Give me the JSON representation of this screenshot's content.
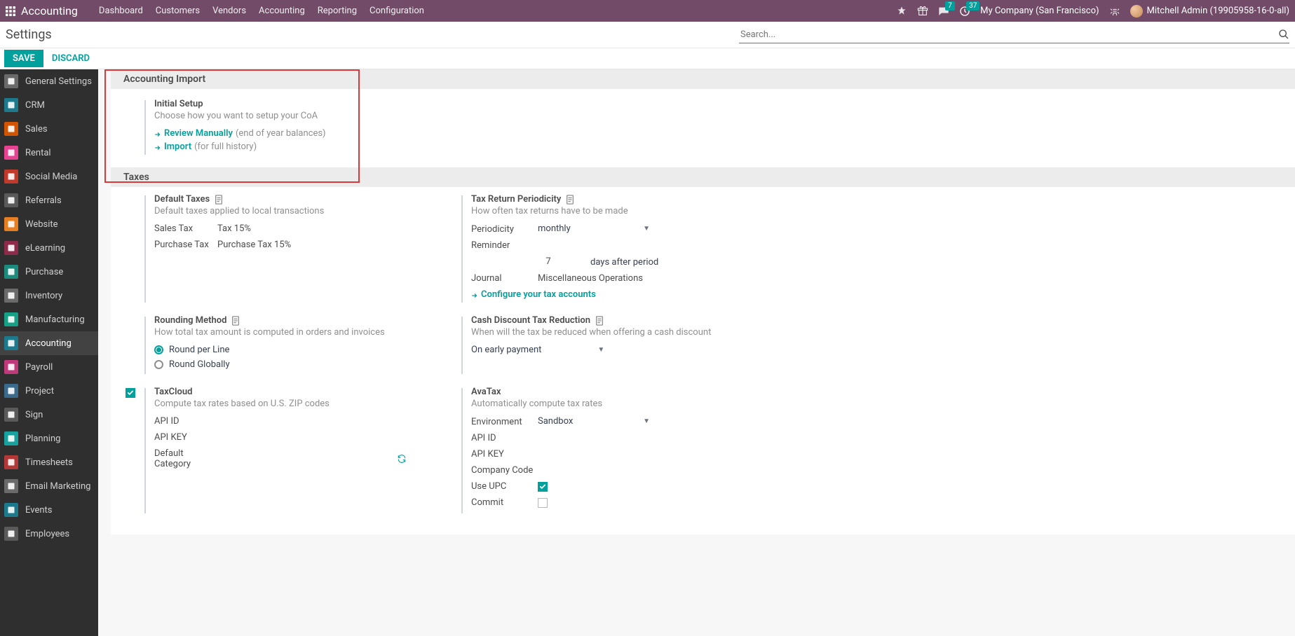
{
  "nav": {
    "app_name": "Accounting",
    "menu": [
      "Dashboard",
      "Customers",
      "Vendors",
      "Accounting",
      "Reporting",
      "Configuration"
    ],
    "msg_badge": "7",
    "activity_badge": "37",
    "company": "My Company (San Francisco)",
    "user": "Mitchell Admin (19905958-16-0-all)"
  },
  "breadcrumb": "Settings",
  "search": {
    "placeholder": "Search..."
  },
  "actions": {
    "save": "SAVE",
    "discard": "DISCARD"
  },
  "sidebar": [
    {
      "label": "General Settings",
      "color": "#6a6a6a"
    },
    {
      "label": "CRM",
      "color": "#1d7a8c"
    },
    {
      "label": "Sales",
      "color": "#d35400"
    },
    {
      "label": "Rental",
      "color": "#e84393"
    },
    {
      "label": "Social Media",
      "color": "#c0392b"
    },
    {
      "label": "Referrals",
      "color": "#5a5a5a"
    },
    {
      "label": "Website",
      "color": "#e67e22"
    },
    {
      "label": "eLearning",
      "color": "#8e2b4a"
    },
    {
      "label": "Purchase",
      "color": "#1c8a7d"
    },
    {
      "label": "Inventory",
      "color": "#6a6a6a"
    },
    {
      "label": "Manufacturing",
      "color": "#16a085"
    },
    {
      "label": "Accounting",
      "color": "#1d7a8c",
      "active": true
    },
    {
      "label": "Payroll",
      "color": "#c0397b"
    },
    {
      "label": "Project",
      "color": "#3a6b8c"
    },
    {
      "label": "Sign",
      "color": "#5a5a5a"
    },
    {
      "label": "Planning",
      "color": "#17a2a0"
    },
    {
      "label": "Timesheets",
      "color": "#b33939"
    },
    {
      "label": "Email Marketing",
      "color": "#6a6a6a"
    },
    {
      "label": "Events",
      "color": "#1d7a8c"
    },
    {
      "label": "Employees",
      "color": "#5a5a5a"
    }
  ],
  "sections": {
    "import": {
      "header": "Accounting Import",
      "initial_title": "Initial Setup",
      "initial_desc": "Choose how you want to setup your CoA",
      "review": "Review Manually",
      "review_note": "(end of year balances)",
      "import_link": "Import",
      "import_note": "(for full history)"
    },
    "taxes": {
      "header": "Taxes",
      "default_taxes": "Default Taxes",
      "default_taxes_desc": "Default taxes applied to local transactions",
      "sales_tax_label": "Sales Tax",
      "sales_tax_value": "Tax 15%",
      "purchase_tax_label": "Purchase Tax",
      "purchase_tax_value": "Purchase Tax 15%",
      "return_title": "Tax Return Periodicity",
      "return_desc": "How often tax returns have to be made",
      "periodicity_label": "Periodicity",
      "periodicity_value": "monthly",
      "reminder_label": "Reminder",
      "reminder_value": "7",
      "reminder_suffix": "days after period",
      "journal_label": "Journal",
      "journal_value": "Miscellaneous Operations",
      "configure_link": "Configure your tax accounts",
      "rounding_title": "Rounding Method",
      "rounding_desc": "How total tax amount is computed in orders and invoices",
      "round_per_line": "Round per Line",
      "round_globally": "Round Globally",
      "cash_discount_title": "Cash Discount Tax Reduction",
      "cash_discount_desc": "When will the tax be reduced when offering a cash discount",
      "cash_discount_value": "On early payment",
      "taxcloud_title": "TaxCloud",
      "taxcloud_desc": "Compute tax rates based on U.S. ZIP codes",
      "api_id": "API ID",
      "api_key": "API KEY",
      "default_category": "Default Category",
      "avatax_title": "AvaTax",
      "avatax_desc": "Automatically compute tax rates",
      "environment_label": "Environment",
      "environment_value": "Sandbox",
      "company_code": "Company Code",
      "use_upc": "Use UPC",
      "commit": "Commit"
    }
  }
}
